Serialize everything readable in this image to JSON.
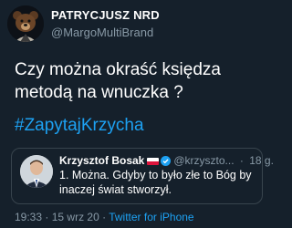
{
  "author": {
    "display_name": "PATRYCJUSZ NRD",
    "handle": "@MargoMultiBrand",
    "avatar_icon": "bear-avatar-icon"
  },
  "tweet": {
    "text": "Czy można okraść księdza metodą na wnuczka ?",
    "hashtag": "#ZapytajKrzycha"
  },
  "quoted": {
    "name": "Krzysztof Bosak",
    "handle": "@krzyszto...",
    "separator": "·",
    "date": "18 g.",
    "text": "1. Można. Gdyby to było złe to Bóg by inaczej świat stworzył.",
    "avatar_icon": "person-avatar-icon",
    "flag_icon": "poland-flag-icon",
    "verified_icon": "verified-badge-icon"
  },
  "footer": {
    "time": "19:33",
    "dot1": "·",
    "date": "15 wrz 20",
    "dot2": "·",
    "source": "Twitter for iPhone"
  },
  "colors": {
    "background": "#15202b",
    "link": "#1da1f2",
    "secondary_text": "#8899a6",
    "border": "#38444d"
  }
}
